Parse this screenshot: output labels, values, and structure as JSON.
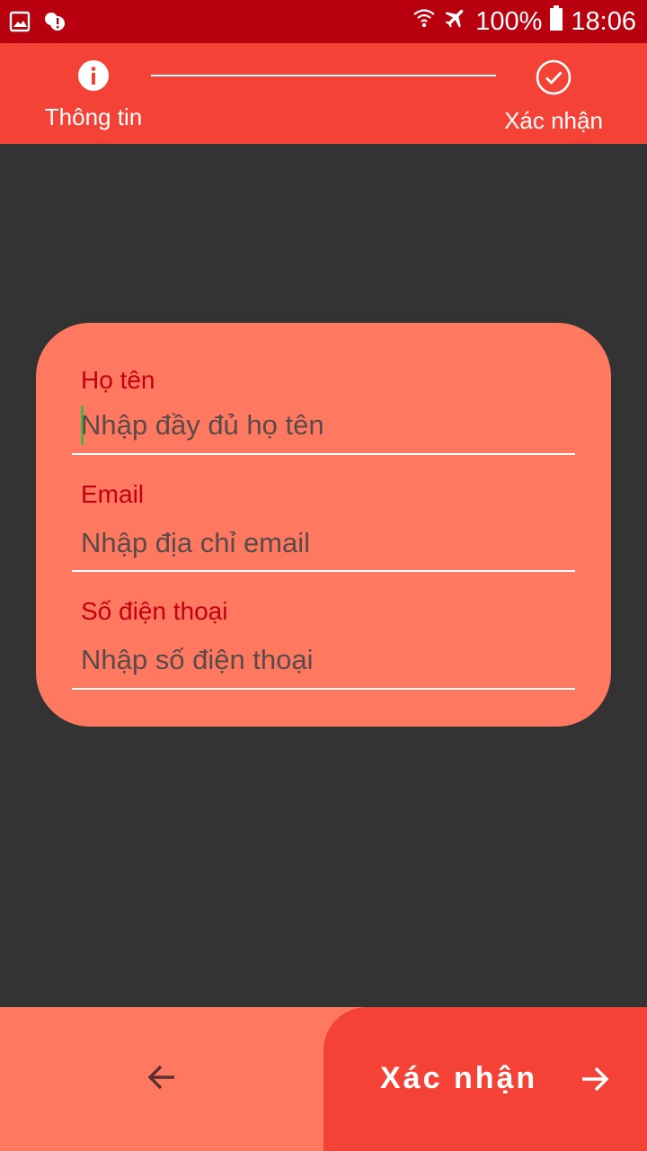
{
  "status_bar": {
    "battery": "100%",
    "time": "18:06",
    "icons": [
      "image-icon",
      "alert-icon",
      "wifi-icon",
      "airplane-icon",
      "battery-icon"
    ]
  },
  "stepper": {
    "steps": [
      {
        "label": "Thông tin",
        "icon": "info-icon",
        "active": true
      },
      {
        "label": "Xác nhận",
        "icon": "check-circle-icon",
        "active": false
      }
    ]
  },
  "form": {
    "fields": [
      {
        "label": "Họ tên",
        "placeholder": "Nhập đầy đủ họ tên",
        "value": ""
      },
      {
        "label": "Email",
        "placeholder": "Nhập địa chỉ email",
        "value": ""
      },
      {
        "label": "Số điện thoại",
        "placeholder": "Nhập số điện thoại",
        "value": ""
      }
    ]
  },
  "bottom_bar": {
    "back_icon": "arrow-left-icon",
    "confirm_label": "Xác nhận",
    "confirm_icon": "arrow-right-icon"
  },
  "colors": {
    "status_bar": "#B8000F",
    "primary": "#F44336",
    "card": "#FF7961",
    "background": "#333333",
    "label": "#C20012",
    "cursor": "#4CAF50"
  }
}
